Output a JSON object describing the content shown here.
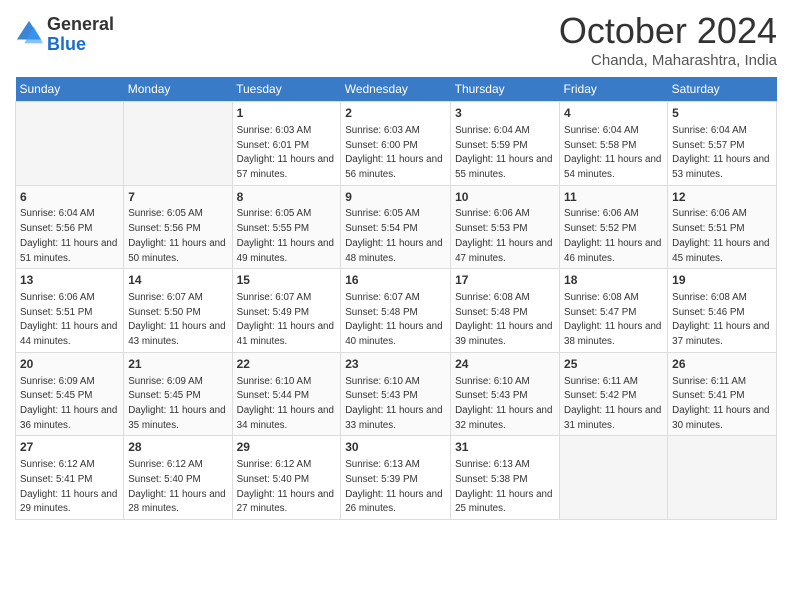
{
  "header": {
    "logo_general": "General",
    "logo_blue": "Blue",
    "month_title": "October 2024",
    "location": "Chanda, Maharashtra, India"
  },
  "columns": [
    "Sunday",
    "Monday",
    "Tuesday",
    "Wednesday",
    "Thursday",
    "Friday",
    "Saturday"
  ],
  "weeks": [
    [
      {
        "day": "",
        "empty": true
      },
      {
        "day": "",
        "empty": true
      },
      {
        "day": "1",
        "sunrise": "Sunrise: 6:03 AM",
        "sunset": "Sunset: 6:01 PM",
        "daylight": "Daylight: 11 hours and 57 minutes."
      },
      {
        "day": "2",
        "sunrise": "Sunrise: 6:03 AM",
        "sunset": "Sunset: 6:00 PM",
        "daylight": "Daylight: 11 hours and 56 minutes."
      },
      {
        "day": "3",
        "sunrise": "Sunrise: 6:04 AM",
        "sunset": "Sunset: 5:59 PM",
        "daylight": "Daylight: 11 hours and 55 minutes."
      },
      {
        "day": "4",
        "sunrise": "Sunrise: 6:04 AM",
        "sunset": "Sunset: 5:58 PM",
        "daylight": "Daylight: 11 hours and 54 minutes."
      },
      {
        "day": "5",
        "sunrise": "Sunrise: 6:04 AM",
        "sunset": "Sunset: 5:57 PM",
        "daylight": "Daylight: 11 hours and 53 minutes."
      }
    ],
    [
      {
        "day": "6",
        "sunrise": "Sunrise: 6:04 AM",
        "sunset": "Sunset: 5:56 PM",
        "daylight": "Daylight: 11 hours and 51 minutes."
      },
      {
        "day": "7",
        "sunrise": "Sunrise: 6:05 AM",
        "sunset": "Sunset: 5:56 PM",
        "daylight": "Daylight: 11 hours and 50 minutes."
      },
      {
        "day": "8",
        "sunrise": "Sunrise: 6:05 AM",
        "sunset": "Sunset: 5:55 PM",
        "daylight": "Daylight: 11 hours and 49 minutes."
      },
      {
        "day": "9",
        "sunrise": "Sunrise: 6:05 AM",
        "sunset": "Sunset: 5:54 PM",
        "daylight": "Daylight: 11 hours and 48 minutes."
      },
      {
        "day": "10",
        "sunrise": "Sunrise: 6:06 AM",
        "sunset": "Sunset: 5:53 PM",
        "daylight": "Daylight: 11 hours and 47 minutes."
      },
      {
        "day": "11",
        "sunrise": "Sunrise: 6:06 AM",
        "sunset": "Sunset: 5:52 PM",
        "daylight": "Daylight: 11 hours and 46 minutes."
      },
      {
        "day": "12",
        "sunrise": "Sunrise: 6:06 AM",
        "sunset": "Sunset: 5:51 PM",
        "daylight": "Daylight: 11 hours and 45 minutes."
      }
    ],
    [
      {
        "day": "13",
        "sunrise": "Sunrise: 6:06 AM",
        "sunset": "Sunset: 5:51 PM",
        "daylight": "Daylight: 11 hours and 44 minutes."
      },
      {
        "day": "14",
        "sunrise": "Sunrise: 6:07 AM",
        "sunset": "Sunset: 5:50 PM",
        "daylight": "Daylight: 11 hours and 43 minutes."
      },
      {
        "day": "15",
        "sunrise": "Sunrise: 6:07 AM",
        "sunset": "Sunset: 5:49 PM",
        "daylight": "Daylight: 11 hours and 41 minutes."
      },
      {
        "day": "16",
        "sunrise": "Sunrise: 6:07 AM",
        "sunset": "Sunset: 5:48 PM",
        "daylight": "Daylight: 11 hours and 40 minutes."
      },
      {
        "day": "17",
        "sunrise": "Sunrise: 6:08 AM",
        "sunset": "Sunset: 5:48 PM",
        "daylight": "Daylight: 11 hours and 39 minutes."
      },
      {
        "day": "18",
        "sunrise": "Sunrise: 6:08 AM",
        "sunset": "Sunset: 5:47 PM",
        "daylight": "Daylight: 11 hours and 38 minutes."
      },
      {
        "day": "19",
        "sunrise": "Sunrise: 6:08 AM",
        "sunset": "Sunset: 5:46 PM",
        "daylight": "Daylight: 11 hours and 37 minutes."
      }
    ],
    [
      {
        "day": "20",
        "sunrise": "Sunrise: 6:09 AM",
        "sunset": "Sunset: 5:45 PM",
        "daylight": "Daylight: 11 hours and 36 minutes."
      },
      {
        "day": "21",
        "sunrise": "Sunrise: 6:09 AM",
        "sunset": "Sunset: 5:45 PM",
        "daylight": "Daylight: 11 hours and 35 minutes."
      },
      {
        "day": "22",
        "sunrise": "Sunrise: 6:10 AM",
        "sunset": "Sunset: 5:44 PM",
        "daylight": "Daylight: 11 hours and 34 minutes."
      },
      {
        "day": "23",
        "sunrise": "Sunrise: 6:10 AM",
        "sunset": "Sunset: 5:43 PM",
        "daylight": "Daylight: 11 hours and 33 minutes."
      },
      {
        "day": "24",
        "sunrise": "Sunrise: 6:10 AM",
        "sunset": "Sunset: 5:43 PM",
        "daylight": "Daylight: 11 hours and 32 minutes."
      },
      {
        "day": "25",
        "sunrise": "Sunrise: 6:11 AM",
        "sunset": "Sunset: 5:42 PM",
        "daylight": "Daylight: 11 hours and 31 minutes."
      },
      {
        "day": "26",
        "sunrise": "Sunrise: 6:11 AM",
        "sunset": "Sunset: 5:41 PM",
        "daylight": "Daylight: 11 hours and 30 minutes."
      }
    ],
    [
      {
        "day": "27",
        "sunrise": "Sunrise: 6:12 AM",
        "sunset": "Sunset: 5:41 PM",
        "daylight": "Daylight: 11 hours and 29 minutes."
      },
      {
        "day": "28",
        "sunrise": "Sunrise: 6:12 AM",
        "sunset": "Sunset: 5:40 PM",
        "daylight": "Daylight: 11 hours and 28 minutes."
      },
      {
        "day": "29",
        "sunrise": "Sunrise: 6:12 AM",
        "sunset": "Sunset: 5:40 PM",
        "daylight": "Daylight: 11 hours and 27 minutes."
      },
      {
        "day": "30",
        "sunrise": "Sunrise: 6:13 AM",
        "sunset": "Sunset: 5:39 PM",
        "daylight": "Daylight: 11 hours and 26 minutes."
      },
      {
        "day": "31",
        "sunrise": "Sunrise: 6:13 AM",
        "sunset": "Sunset: 5:38 PM",
        "daylight": "Daylight: 11 hours and 25 minutes."
      },
      {
        "day": "",
        "empty": true
      },
      {
        "day": "",
        "empty": true
      }
    ]
  ]
}
